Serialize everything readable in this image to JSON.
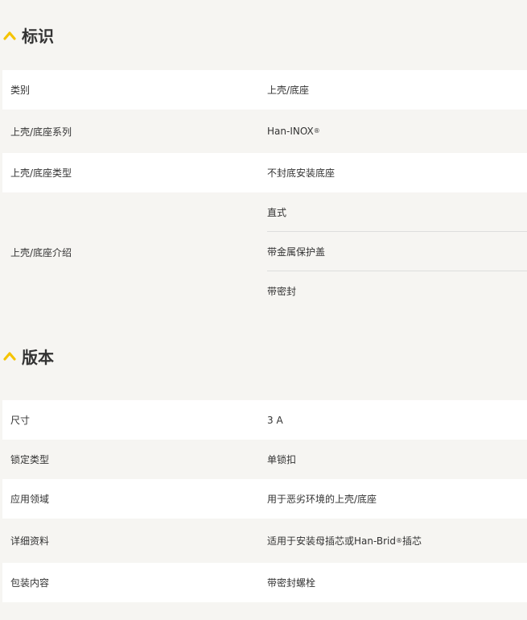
{
  "sections": {
    "identification": {
      "title": "标识",
      "rows": [
        {
          "label": "类别",
          "value": "上壳/底座"
        },
        {
          "label": "上壳/底座系列",
          "value": "Han-INOX",
          "value_sup": "®"
        },
        {
          "label": "上壳/底座类型",
          "value": "不封底安装底座"
        },
        {
          "label": "上壳/底座介绍",
          "values": [
            "直式",
            "带金属保护盖",
            "带密封"
          ]
        }
      ]
    },
    "version": {
      "title": "版本",
      "rows": [
        {
          "label": "尺寸",
          "value": "3 A"
        },
        {
          "label": "锁定类型",
          "value": "单锁扣"
        },
        {
          "label": "应用领域",
          "value": "用于恶劣环境的上壳/底座"
        },
        {
          "label": "详细资料",
          "value": "适用于安装母插芯或Han-Brid",
          "value_sup": "®",
          "value_suffix": "插芯"
        },
        {
          "label": "包装内容",
          "value": "带密封螺栓"
        }
      ]
    }
  },
  "colors": {
    "accent": "#f5c400",
    "row_white": "#ffffff",
    "row_grey": "#f6f5f2",
    "text": "#333333"
  },
  "icons": {
    "section_toggle": "chevron-up-icon"
  }
}
